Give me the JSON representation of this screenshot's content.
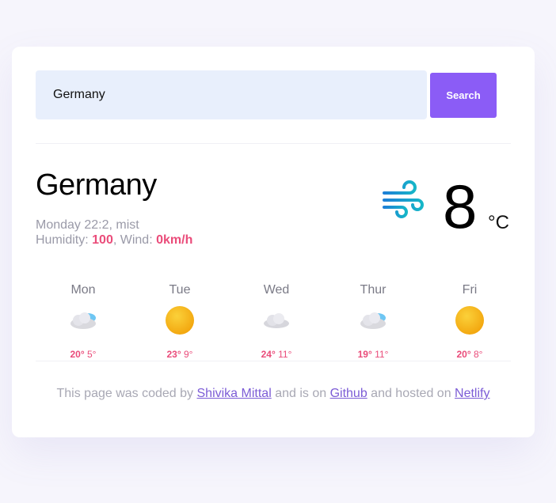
{
  "search": {
    "value": "Germany",
    "placeholder": "",
    "button_label": "Search"
  },
  "current": {
    "city": "Germany",
    "datetime": "Monday 22:2",
    "condition": "mist",
    "humidity_label": "Humidity:",
    "humidity": "100",
    "wind_label": "Wind:",
    "wind": "0km/h",
    "temperature": "8",
    "unit": "°C",
    "icon": "wind-icon"
  },
  "forecast": [
    {
      "day": "Mon",
      "hi": "20°",
      "lo": "5°",
      "icon": "partly-cloudy-icon"
    },
    {
      "day": "Tue",
      "hi": "23°",
      "lo": "9°",
      "icon": "sun-icon"
    },
    {
      "day": "Wed",
      "hi": "24°",
      "lo": "11°",
      "icon": "cloud-icon"
    },
    {
      "day": "Thur",
      "hi": "19°",
      "lo": "11°",
      "icon": "partly-cloudy-icon"
    },
    {
      "day": "Fri",
      "hi": "20°",
      "lo": "8°",
      "icon": "sun-icon"
    }
  ],
  "footer": {
    "text1": "This page was coded by ",
    "author": "Shivika Mittal",
    "text2": " and is on ",
    "github": "Github",
    "text3": " and hosted on ",
    "netlify": "Netlify"
  },
  "colors": {
    "accent": "#8b5cf6",
    "highlight": "#ea4c7a",
    "link": "#7c5cd6",
    "input_bg": "#e8effc"
  }
}
